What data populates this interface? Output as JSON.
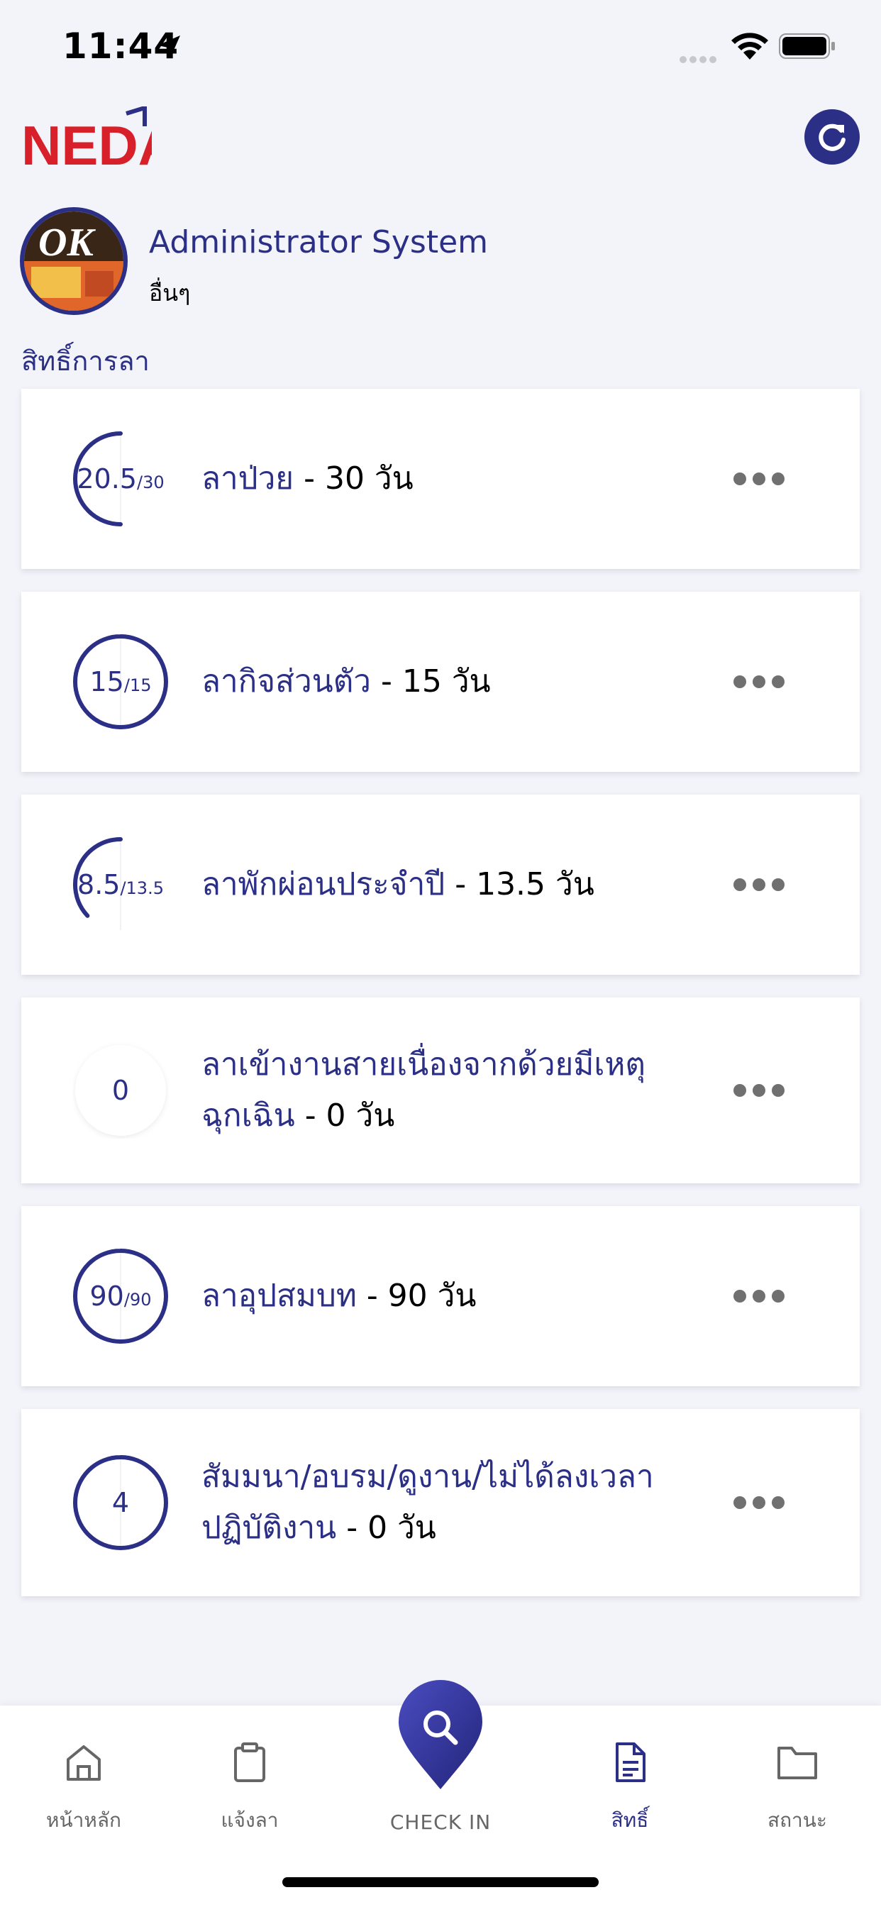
{
  "status_bar": {
    "time": "11:44"
  },
  "header": {
    "logo_text": "NEDA"
  },
  "profile": {
    "name": "Administrator System",
    "role": "อื่นๆ",
    "avatar_text": "OK"
  },
  "section_title": "สิทธิ์การลา",
  "leave_types": [
    {
      "value": "20.5",
      "total": "/30",
      "progress": 0.5,
      "label": "ลาป่วย",
      "days": " - 30 วัน"
    },
    {
      "value": "15",
      "total": "/15",
      "progress": 1.0,
      "label": "ลากิจส่วนตัว",
      "days": " - 15 วัน"
    },
    {
      "value": "8.5",
      "total": "/13.5",
      "progress": 0.37,
      "label": "ลาพักผ่อนประจำปี",
      "days": " - 13.5 วัน"
    },
    {
      "value": "0",
      "total": "",
      "progress": 0.0,
      "label_line1": "ลาเข้างานสายเนื่องจากด้วยมีเหตุ",
      "label_line2": "ฉุกเฉิน",
      "days": " - 0 วัน"
    },
    {
      "value": "90",
      "total": "/90",
      "progress": 1.0,
      "label": "ลาอุปสมบท",
      "days": " - 90 วัน"
    },
    {
      "value": "4",
      "total": "",
      "progress": 1.0,
      "label_line1": "สัมมนา/อบรม/ดูงาน/ไม่ได้ลงเวลา",
      "label_line2": "ปฏิบัติงาน",
      "days": " - 0 วัน"
    }
  ],
  "nav": {
    "home": "หน้าหลัก",
    "leave_request": "แจ้งลา",
    "checkin": "CHECK IN",
    "rights": "สิทธิ์",
    "status": "สถานะ"
  },
  "colors": {
    "primary": "#2b2f86",
    "background": "#f3f3fa",
    "muted": "#707070"
  }
}
